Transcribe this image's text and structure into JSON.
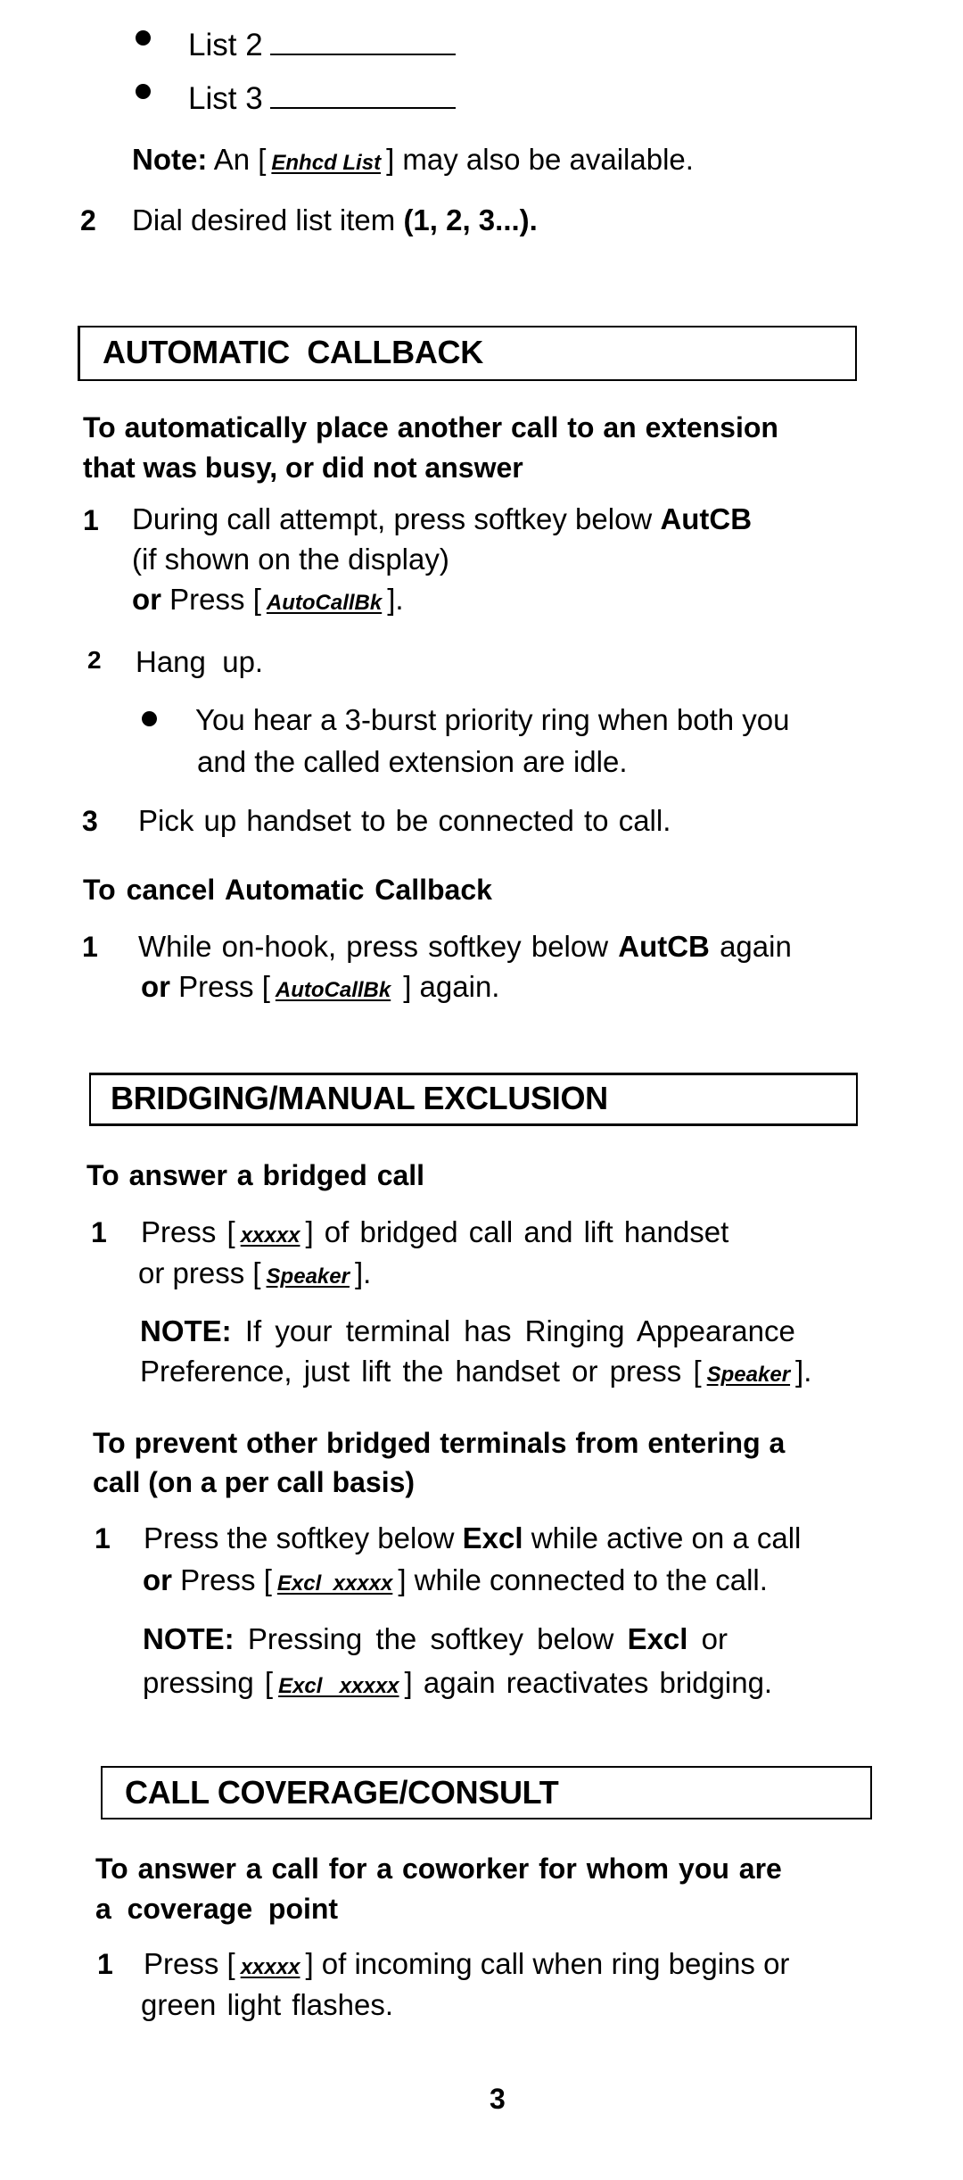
{
  "top_list": {
    "items": [
      {
        "label": "List 2"
      },
      {
        "label": "List 3"
      }
    ],
    "note": {
      "label": "Note:",
      "pre": "An [",
      "key": "Enhcd List",
      "post": "] may also be available."
    },
    "step2": {
      "num": "2",
      "pre": "Dial desired list item",
      "bold": "(1, 2, 3...)."
    }
  },
  "automatic_callback": {
    "title": "AUTOMATIC  CALLBACK",
    "heading": [
      "To automatically place another call to an extension",
      "that was busy, or did not answer"
    ],
    "steps": [
      {
        "num": "1",
        "line1_pre": "During call attempt, press softkey below",
        "line1_bold": "AutCB",
        "line2": "(if shown on the display)",
        "line3_or": "or",
        "line3_pre": "Press [",
        "line3_key": "AutoCallBk",
        "line3_post": "]."
      },
      {
        "num": "2",
        "text": "Hang  up.",
        "bullet": [
          "You hear a 3-burst priority ring when both you",
          "and the called extension are idle."
        ]
      },
      {
        "num": "3",
        "text": "Pick up handset to be connected to call."
      }
    ],
    "cancel": {
      "heading": "To cancel Automatic Callback",
      "num": "1",
      "line1_pre": "While on-hook, press softkey below",
      "line1_bold": "AutCB",
      "line1_post": "again",
      "line2_or": "or",
      "line2_pre": "Press [",
      "line2_key": "AutoCallBk",
      "line2_post": "] again."
    }
  },
  "bridging": {
    "title": "BRIDGING/MANUAL EXCLUSION",
    "answer": {
      "heading": "To answer a bridged call",
      "num": "1",
      "line1_pre": "Press [",
      "line1_key": "xxxxx",
      "line1_post": "] of bridged call and lift handset",
      "line2_pre": "or press [",
      "line2_key": "Speaker",
      "line2_post": "].",
      "note_label": "NOTE:",
      "note_line1": "If your terminal has Ringing Appearance",
      "note_line2_pre": "Preference, just lift the handset or press [",
      "note_line2_key": "Speaker",
      "note_line2_post": "]."
    },
    "prevent": {
      "heading": [
        "To prevent other bridged terminals from entering a",
        "call (on a per call basis)"
      ],
      "num": "1",
      "line1_pre": "Press the softkey below",
      "line1_bold": "Excl",
      "line1_post": "while active on a call",
      "line2_or": "or",
      "line2_pre": "Press [",
      "line2_key": "Excl  xxxxx",
      "line2_post": "] while connected to the call.",
      "note_label": "NOTE:",
      "note_line1_pre": "Pressing the softkey below",
      "note_line1_bold": "Excl",
      "note_line1_post": "or",
      "note_line2_pre": "pressing [",
      "note_line2_key": "Excl  xxxxx",
      "note_line2_post": "] again reactivates bridging."
    }
  },
  "call_coverage": {
    "title": "CALL COVERAGE/CONSULT",
    "heading": [
      "To answer a call for a coworker for whom you are",
      "a  coverage  point"
    ],
    "num": "1",
    "line1_pre": "Press [",
    "line1_key": "xxxxx",
    "line1_post": "] of incoming call when ring begins or",
    "line2": "green light flashes."
  },
  "page_number": "3"
}
